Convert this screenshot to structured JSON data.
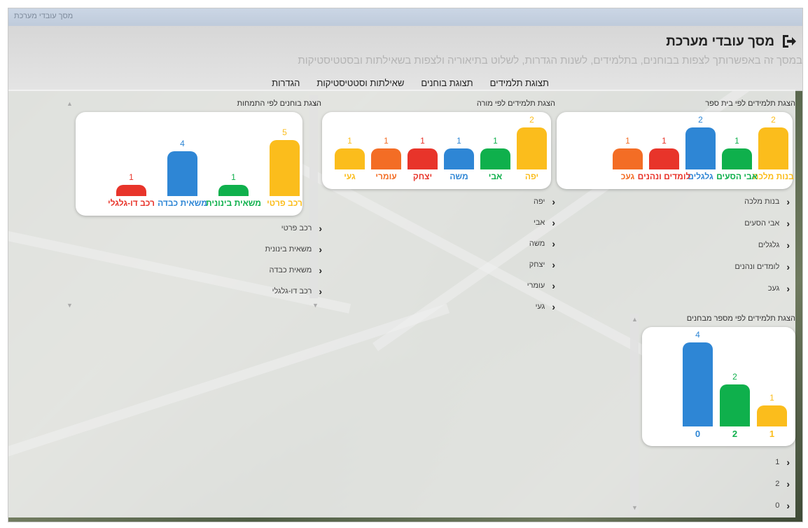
{
  "window": {
    "title": "מסך עובדי מערכת"
  },
  "header": {
    "title": "מסך עובדי מערכת",
    "subtitle": "במסך זה באפשרותך לצפות בבוחנים, בתלמידים, לשנות הגדרות, לשלוט בתיאוריה ולצפות בשאילתות ובסטטיסטיקות",
    "exit_icon": "exit-icon"
  },
  "tabs": [
    {
      "label": "תצוגת תלמידים",
      "active": false
    },
    {
      "label": "תצוגת בוחנים",
      "active": false
    },
    {
      "label": "שאילתות וסטטיסטיקות",
      "active": true
    },
    {
      "label": "הגדרות",
      "active": false
    }
  ],
  "colors": {
    "yellow": "#fbbd1c",
    "green": "#0fb04c",
    "blue": "#2e86d5",
    "red": "#e8342a",
    "orange": "#f36d25"
  },
  "sections": {
    "by_school": {
      "title": "הצגת תלמידים לפי בית ספר",
      "items": [
        "בנות מלכה",
        "אבי הסעים",
        "גלגלים",
        "לומדים ונהנים",
        "געכ"
      ]
    },
    "by_teacher": {
      "title": "הצגת תלמידים לפי מורה",
      "items": [
        "יפה",
        "אבי",
        "משה",
        "יצחק",
        "עומרי",
        "געי"
      ]
    },
    "by_specialty": {
      "title": "הצגת בוחנים לפי התמחות",
      "items": [
        "רכב פרטי",
        "משאית בינונית",
        "משאית כבדה",
        "רכב דו-גלגלי"
      ]
    },
    "by_tests": {
      "title": "הצגת תלמידים לפי מספר מבחנים",
      "items": [
        "1",
        "2",
        "0"
      ]
    }
  },
  "chart_data": [
    {
      "type": "bar",
      "title": "הצגת תלמידים לפי בית ספר",
      "categories": [
        "בנות מלכה",
        "אבי הסעים",
        "גלגלים",
        "לומדים ונהנים",
        "געכ"
      ],
      "values": [
        2,
        1,
        2,
        1,
        1
      ],
      "colors": [
        "#fbbd1c",
        "#0fb04c",
        "#2e86d5",
        "#e8342a",
        "#f36d25"
      ]
    },
    {
      "type": "bar",
      "title": "הצגת תלמידים לפי מורה",
      "categories": [
        "יפה",
        "אבי",
        "משה",
        "יצחק",
        "עומרי",
        "געי"
      ],
      "values": [
        2,
        1,
        1,
        1,
        1,
        1
      ],
      "colors": [
        "#fbbd1c",
        "#0fb04c",
        "#2e86d5",
        "#e8342a",
        "#f36d25",
        "#fbbd1c"
      ]
    },
    {
      "type": "bar",
      "title": "הצגת בוחנים לפי התמחות",
      "categories": [
        "רכב פרטי",
        "משאית בינונית",
        "משאית כבדה",
        "רכב דו-גלגלי"
      ],
      "values": [
        5,
        1,
        4,
        1
      ],
      "colors": [
        "#fbbd1c",
        "#0fb04c",
        "#2e86d5",
        "#e8342a"
      ]
    },
    {
      "type": "bar",
      "title": "הצגת תלמידים לפי מספר מבחנים",
      "categories": [
        "1",
        "2",
        "0"
      ],
      "values": [
        1,
        2,
        4
      ],
      "colors": [
        "#fbbd1c",
        "#0fb04c",
        "#2e86d5"
      ]
    }
  ]
}
